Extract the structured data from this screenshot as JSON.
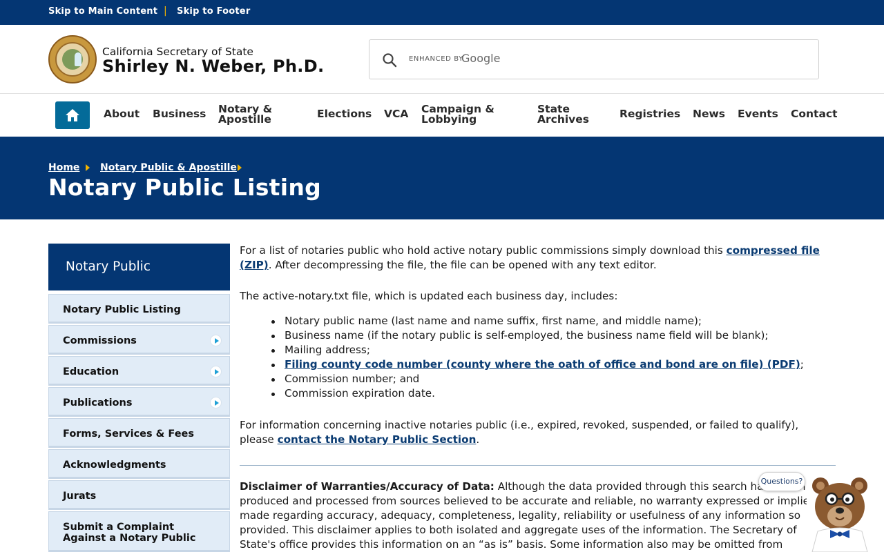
{
  "skip_links": {
    "main": "Skip to Main Content",
    "separator": "|",
    "footer": "Skip to Footer"
  },
  "header": {
    "org": "California Secretary of State",
    "official": "Shirley N. Weber, Ph.D.",
    "seal_icon": "state-seal-icon",
    "search": {
      "enhanced_by": "ENHANCED BY",
      "provider": "Google",
      "value": ""
    }
  },
  "nav": {
    "home_icon": "home-icon",
    "items": [
      "About",
      "Business",
      "Notary & Apostille",
      "Elections",
      "VCA",
      "Campaign & Lobbying",
      "State Archives",
      "Registries",
      "News",
      "Events",
      "Contact"
    ]
  },
  "banner": {
    "breadcrumbs": [
      "Home",
      "Notary Public & Apostille"
    ],
    "title": "Notary Public Listing"
  },
  "sidebar": {
    "heading": "Notary Public",
    "items": [
      {
        "label": "Notary Public Listing"
      },
      {
        "label": "Commissions"
      },
      {
        "label": "Education"
      },
      {
        "label": "Publications"
      },
      {
        "label": "Forms, Services & Fees"
      },
      {
        "label": "Acknowledgments"
      },
      {
        "label": "Jurats"
      },
      {
        "label": "Submit a Complaint Against a Notary Public"
      }
    ]
  },
  "content": {
    "p1_before": "For a list of notaries public who hold active notary public commissions simply download this ",
    "p1_link": "compressed file (ZIP)",
    "p1_after": ". After decompressing the file, the file can be opened with any text editor.",
    "p2": "The active-notary.txt file, which is updated each business day, includes:",
    "list": [
      "Notary public name (last name and name suffix, first name, and middle name);",
      "Business name (if the notary public is self-employed, the business name field will be blank);",
      "Mailing address;",
      "Filing county code number (county where the oath of office and bond are on file) (PDF)",
      "Commission number; and",
      "Commission expiration date."
    ],
    "list_link_suffix": ";",
    "p3_before": "For information concerning inactive notaries public (i.e., expired, revoked, suspended, or failed to qualify), please ",
    "p3_link": "contact the Notary Public Section",
    "p3_after": ".",
    "disclaimer_label": "Disclaimer of Warranties/Accuracy of Data:",
    "disclaimer_text": " Although the data provided through this search have been produced and processed from sources believed to be accurate and reliable, no warranty expressed or implied is made regarding accuracy, adequacy, completeness, legality, reliability or usefulness of any information so provided. This disclaimer applies to both isolated and aggregate uses of the information. The Secretary of State's office provides this information on an “as is” basis. Some information also may be omitted from publication as"
  },
  "chat": {
    "bubble": "Questions?",
    "icon": "bear-mascot-icon"
  },
  "colors": {
    "navy": "#043673",
    "accent_gold": "#f4b400",
    "home_button": "#046b99",
    "sidebar_item": "#e1ecf7",
    "link": "#0a3b72"
  }
}
